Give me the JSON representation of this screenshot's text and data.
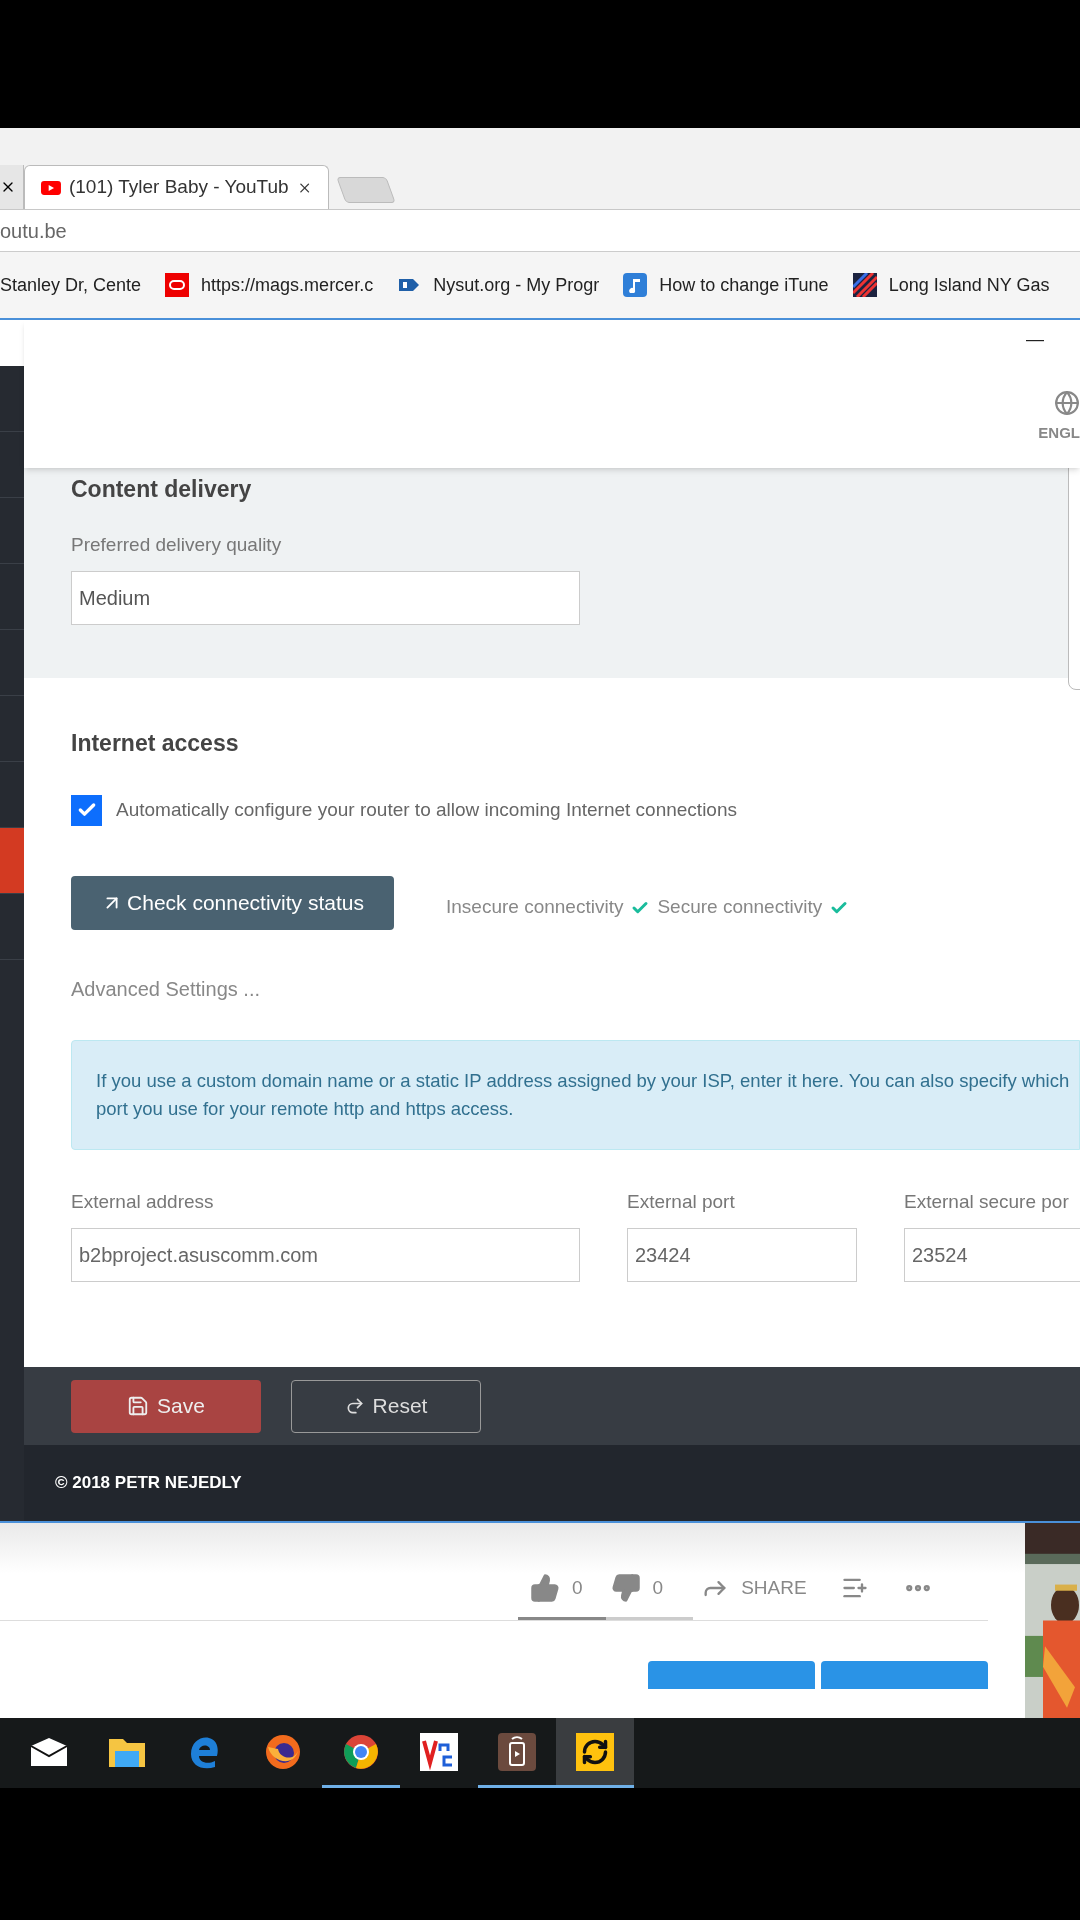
{
  "browser": {
    "tabs": [
      {
        "selected": false
      },
      {
        "title": "(101) Tyler Baby - YouTub",
        "selected": true
      }
    ],
    "address": "outu.be",
    "bookmarks": [
      {
        "label": "Stanley Dr, Cente",
        "kind": "blank"
      },
      {
        "label": "https://mags.mercer.c",
        "kind": "ring"
      },
      {
        "label": "Nysut.org - My Progr",
        "kind": "tag"
      },
      {
        "label": "How to change iTune",
        "kind": "music"
      },
      {
        "label": "Long Island NY Gas",
        "kind": "stripes"
      }
    ]
  },
  "app": {
    "minimize": "—",
    "language": "ENGL",
    "sidebar": {
      "items": [
        {
          "selected": false
        },
        {
          "selected": false
        },
        {
          "selected": false
        },
        {
          "selected": false
        },
        {
          "selected": false
        },
        {
          "selected": false
        },
        {
          "selected": false
        },
        {
          "selected": true
        },
        {
          "selected": false
        }
      ]
    },
    "content_delivery": {
      "title": "Content delivery",
      "label": "Preferred delivery quality",
      "value": "Medium"
    },
    "internet_access": {
      "title": "Internet access",
      "auto_configure": {
        "label": "Automatically configure your router to allow incoming Internet connections",
        "checked": true
      },
      "check_button": "Check connectivity status",
      "statuses": [
        {
          "label": "Insecure connectivity",
          "ok": true
        },
        {
          "label": "Secure connectivity",
          "ok": true
        }
      ],
      "advanced": "Advanced Settings ...",
      "info": "If you use a custom domain name or a static IP address assigned by your ISP, enter it here. You can also specify which port you use for your remote http and https access.",
      "fields": [
        {
          "label": "External address",
          "value": "b2bproject.asuscomm.com"
        },
        {
          "label": "External port",
          "value": "23424"
        },
        {
          "label": "External secure por",
          "value": "23524"
        }
      ]
    },
    "save": "Save",
    "reset": "Reset",
    "copyright": "© 2018 PETR NEJEDLY"
  },
  "video_page": {
    "likes": "0",
    "dislikes": "0",
    "share": "SHARE",
    "like_bar": {
      "level": 0.5
    }
  },
  "taskbar": [
    {
      "kind": "mail",
      "running": false,
      "selected": false
    },
    {
      "kind": "folder",
      "running": false,
      "selected": false
    },
    {
      "kind": "edge",
      "running": false,
      "selected": false
    },
    {
      "kind": "firefox",
      "running": false,
      "selected": false
    },
    {
      "kind": "chrome",
      "running": true,
      "selected": false
    },
    {
      "kind": "vnc",
      "running": false,
      "selected": false
    },
    {
      "kind": "remote",
      "running": true,
      "selected": false
    },
    {
      "kind": "sync",
      "running": true,
      "selected": true
    }
  ]
}
